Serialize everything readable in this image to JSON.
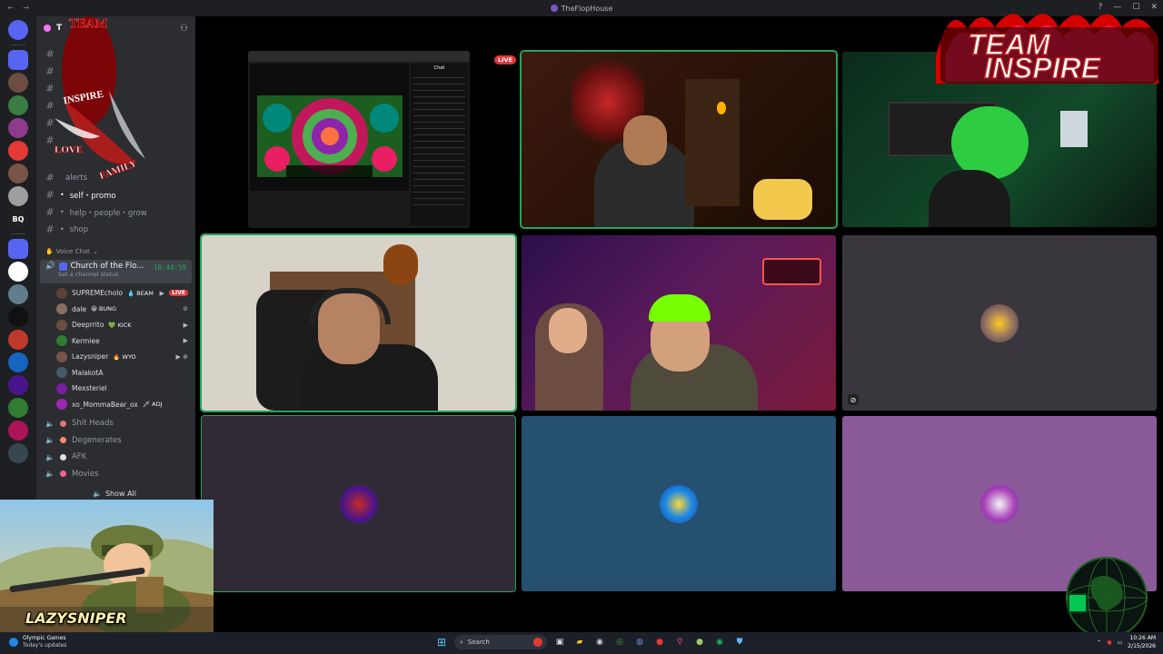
{
  "window": {
    "title": "TheFlopHouse"
  },
  "server": {
    "name": "T"
  },
  "server_rail": [
    {
      "icon": "discord-home-icon",
      "color": "#5865f2",
      "label": ""
    },
    {
      "icon": "folder-icon",
      "color": "#5865f2",
      "label": ""
    },
    {
      "icon": "server-avatar-icon",
      "color": "#6d4c41",
      "label": ""
    },
    {
      "icon": "server-avatar-icon",
      "color": "#3a7d44",
      "label": ""
    },
    {
      "icon": "server-avatar-icon",
      "color": "#8e3b8e",
      "label": ""
    },
    {
      "icon": "server-avatar-icon",
      "color": "#e53935",
      "label": ""
    },
    {
      "icon": "server-avatar-icon",
      "color": "#795548",
      "label": ""
    },
    {
      "icon": "server-avatar-icon",
      "color": "#9e9e9e",
      "label": ""
    },
    {
      "icon": "server-avatar-icon",
      "color": "#222222",
      "label": "BQ"
    },
    {
      "icon": "folder-icon",
      "color": "#5865f2",
      "label": ""
    },
    {
      "icon": "server-avatar-icon",
      "color": "#ffffff",
      "label": ""
    },
    {
      "icon": "server-avatar-icon",
      "color": "#607d8b",
      "label": ""
    },
    {
      "icon": "server-avatar-icon",
      "color": "#111111",
      "label": ""
    },
    {
      "icon": "server-avatar-icon",
      "color": "#c0392b",
      "label": ""
    },
    {
      "icon": "server-avatar-icon",
      "color": "#1565c0",
      "label": ""
    },
    {
      "icon": "server-avatar-icon",
      "color": "#4a148c",
      "label": ""
    },
    {
      "icon": "server-avatar-icon",
      "color": "#2e7d32",
      "label": ""
    },
    {
      "icon": "server-avatar-icon",
      "color": "#ad1457",
      "label": ""
    },
    {
      "icon": "server-avatar-icon",
      "color": "#37474f",
      "label": ""
    }
  ],
  "text_channels": [
    {
      "name": "alerts",
      "emoji": ""
    },
    {
      "name": "self・promo",
      "emoji": "•",
      "active": true
    },
    {
      "name": "help・people・grow",
      "emoji": "•"
    },
    {
      "name": "shop",
      "emoji": "•"
    }
  ],
  "voice_category": "Voice Chat",
  "active_voice": {
    "name": "Church of the Flo...",
    "time": "10:44:59",
    "status": "Set a channel status"
  },
  "voice_users": [
    {
      "name": "SUPREMEcholo",
      "tag": "💧 BEAM",
      "live": "LIVE",
      "color": "#5d4037"
    },
    {
      "name": "dale",
      "tag": "😀 BUNG",
      "color": "#8d6e63"
    },
    {
      "name": "Deeprrito",
      "tag": "💚 KICK",
      "color": "#6d4c41"
    },
    {
      "name": "Kermiee",
      "tag": "",
      "color": "#2e7d32"
    },
    {
      "name": "Lazysniper",
      "tag": "🔥 WYO",
      "color": "#795548"
    },
    {
      "name": "MalakotA",
      "tag": "",
      "color": "#455a64"
    },
    {
      "name": "Mexsteriel",
      "tag": "",
      "color": "#7b1fa2"
    },
    {
      "name": "xo_MommaBear_ox",
      "tag": "🗡 ADJ",
      "color": "#9c27b0"
    }
  ],
  "voice_channels": [
    {
      "name": "Shit Heads"
    },
    {
      "name": "Degenerates"
    },
    {
      "name": "AFK"
    },
    {
      "name": "Movies"
    }
  ],
  "show_all_label": "Show All",
  "stream": {
    "live_label": "LIVE",
    "chat_title": "Chat"
  },
  "stream_overlay": {
    "name": "LAZYSNIPER"
  },
  "team_logo": {
    "line1": "TEAM",
    "line2": "INSPIRE"
  },
  "team_logo_left": {
    "text1": "TEAM",
    "text2": "INSPIRE",
    "text3": "LOVE",
    "text4": "FAMILY"
  },
  "taskbar": {
    "weather_title": "Olympic Games",
    "weather_sub": "Today's updates",
    "search_placeholder": "Search",
    "time": "10:26 AM",
    "date": "2/15/2026"
  }
}
